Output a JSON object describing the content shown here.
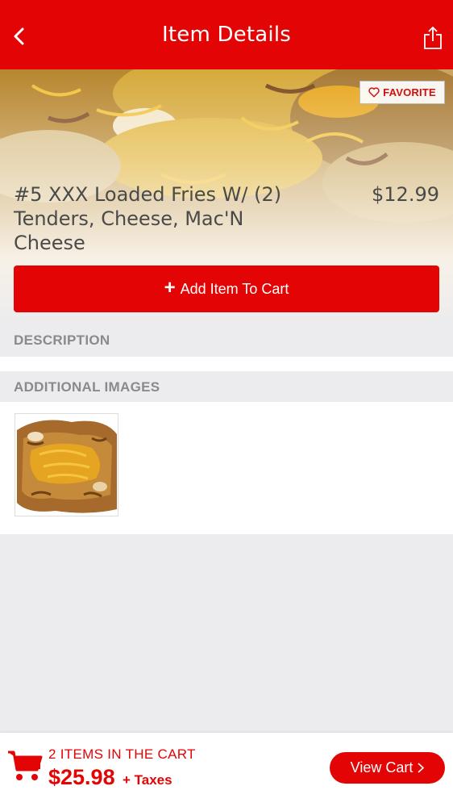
{
  "header": {
    "title": "Item Details",
    "back_icon": "chevron-left-icon",
    "share_icon": "share-icon"
  },
  "item": {
    "favorite_label": "FAVORITE",
    "name_lines": [
      "#5 XXX Loaded Fries W/ (2)",
      "Tenders, Cheese, Mac'N",
      "Cheese"
    ],
    "price": "$12.99",
    "add_to_cart_label": "Add Item To Cart"
  },
  "sections": {
    "description_header": "DESCRIPTION",
    "additional_images_header": "ADDITIONAL IMAGES"
  },
  "footer": {
    "items_in_cart": "2 ITEMS IN THE CART",
    "total": "$25.98",
    "taxes": "+ Taxes",
    "view_cart_label": "View Cart"
  },
  "colors": {
    "brand_red": "#e30505",
    "text_gray": "#4a4a4a",
    "section_gray": "#8a8a8a",
    "background": "#ececee"
  }
}
